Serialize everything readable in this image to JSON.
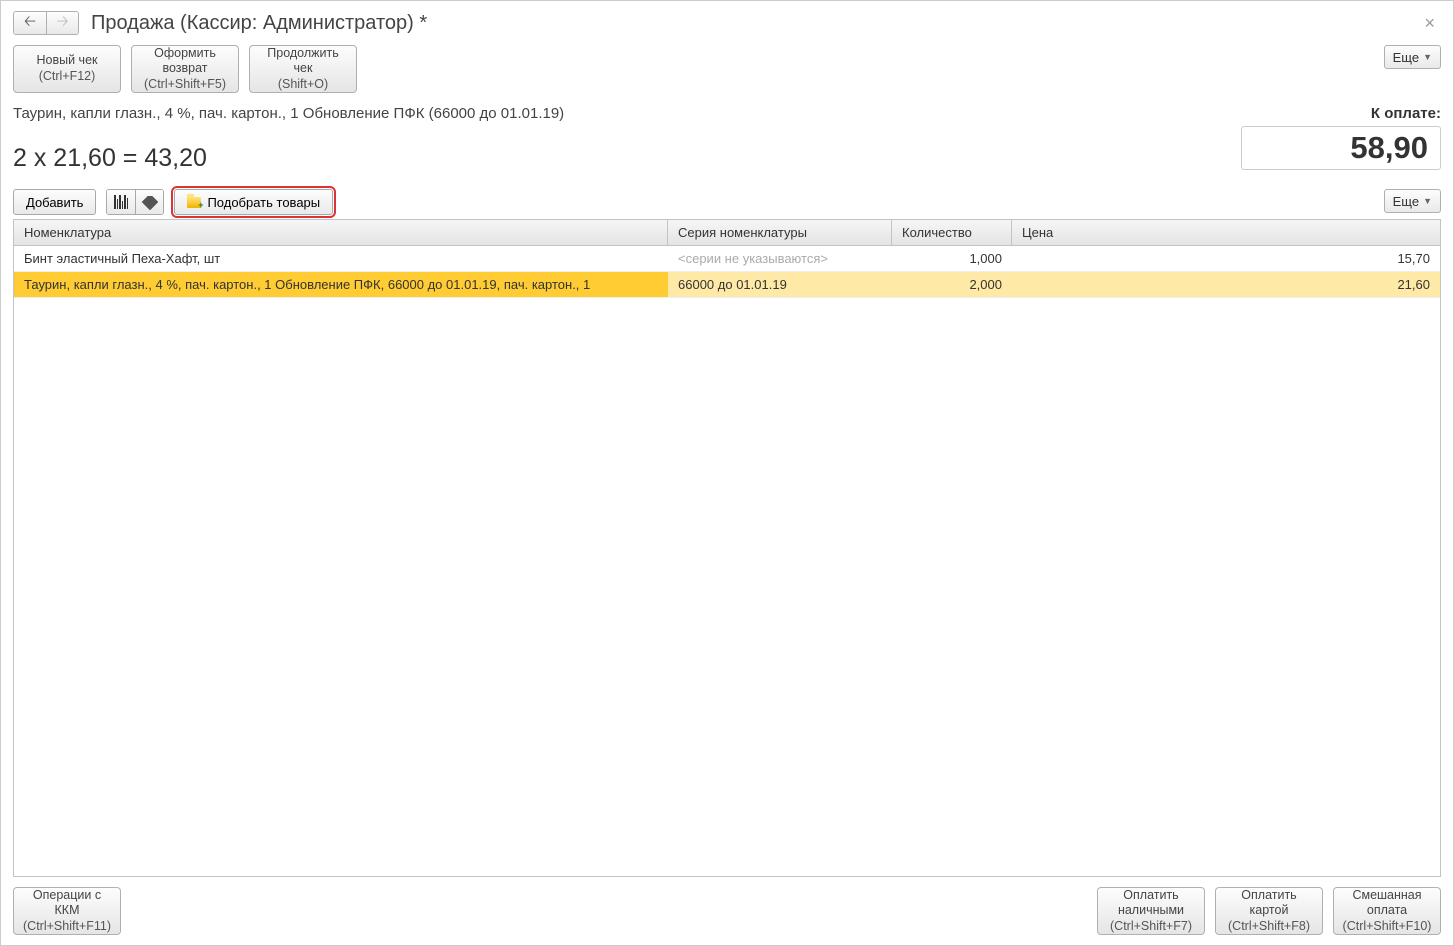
{
  "window": {
    "title": "Продажа (Кассир: Администратор) *"
  },
  "topButtons": {
    "newReceipt": {
      "label": "Новый чек",
      "shortcut": "(Ctrl+F12)"
    },
    "issueReturn": {
      "label1": "Оформить",
      "label2": "возврат",
      "shortcut": "(Ctrl+Shift+F5)"
    },
    "continueReceipt": {
      "label1": "Продолжить",
      "label2": "чек",
      "shortcut": "(Shift+O)"
    },
    "more": "Еще"
  },
  "info": {
    "productLine": "Таурин, капли глазн., 4 %, пач. картон., 1  Обновление ПФК (66000 до 01.01.19)",
    "calcLine": "2 х 21,60 = 43,20",
    "payLabel": "К оплате:",
    "payTotal": "58,90"
  },
  "toolbar2": {
    "add": "Добавить",
    "pick": "Подобрать товары",
    "more": "Еще"
  },
  "grid": {
    "headers": {
      "nomenclature": "Номенклатура",
      "series": "Серия номенклатуры",
      "qty": "Количество",
      "price": "Цена"
    },
    "rows": [
      {
        "nomenclature": "Бинт эластичный Пеха-Хафт, шт",
        "series": "<серии не указываются>",
        "seriesMuted": true,
        "qty": "1,000",
        "price": "15,70",
        "selected": false
      },
      {
        "nomenclature": "Таурин, капли глазн., 4 %, пач. картон., 1  Обновление ПФК, 66000 до 01.01.19, пач. картон., 1",
        "series": "66000 до 01.01.19",
        "seriesMuted": false,
        "qty": "2,000",
        "price": "21,60",
        "selected": true
      }
    ]
  },
  "footer": {
    "kkm": {
      "label1": "Операции с",
      "label2": "ККМ",
      "shortcut": "(Ctrl+Shift+F11)"
    },
    "payCash": {
      "label1": "Оплатить",
      "label2": "наличными",
      "shortcut": "(Ctrl+Shift+F7)"
    },
    "payCard": {
      "label1": "Оплатить",
      "label2": "картой",
      "shortcut": "(Ctrl+Shift+F8)"
    },
    "payMixed": {
      "label1": "Смешанная",
      "label2": "оплата",
      "shortcut": "(Ctrl+Shift+F10)"
    }
  }
}
